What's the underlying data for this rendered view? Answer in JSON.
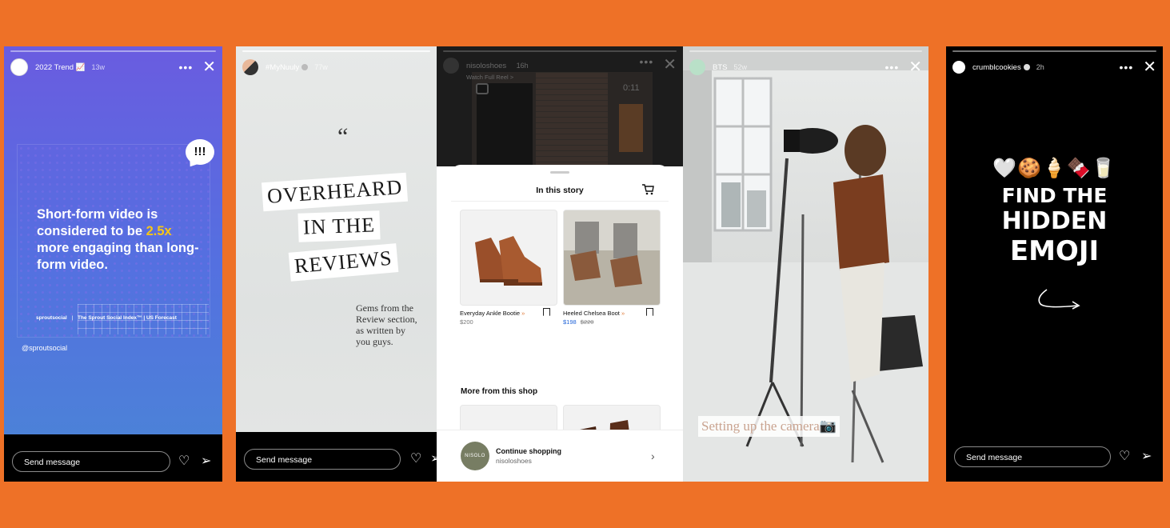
{
  "colors": {
    "background": "#ee7127",
    "accent_yellow": "#f5c518",
    "price_sale": "#1f63d8"
  },
  "stories": [
    {
      "username": "2022 Trend 📈",
      "time": "13w",
      "headline_pre": "Short-form video is considered to be ",
      "headline_highlight": "2.5x",
      "headline_post": " more engaging than long-form video.",
      "brand": "sproutsocial",
      "source": "The Sprout Social Index™ | US Forecast",
      "handle": "@sproutsocial",
      "bubble": "!!!",
      "send_placeholder": "Send message"
    },
    {
      "username": "#MyNuuly",
      "time": "77w",
      "quote_mark": "“",
      "title_lines": [
        "OVERHEARD",
        "IN THE",
        "REVIEWS"
      ],
      "subtitle_lines": [
        "Gems from the",
        "Review section,",
        "as written by",
        "you guys."
      ],
      "send_placeholder": "Send message"
    },
    {
      "username": "nisoloshoes",
      "time": "16h",
      "watch_label": "Watch Full Reel >",
      "video_time": "0:11",
      "sheet_title": "In this story",
      "products": [
        {
          "name": "Everyday Ankle Bootie",
          "price": "$200",
          "sale_price": "",
          "original_price": ""
        },
        {
          "name": "Heeled Chelsea Boot",
          "price": "",
          "sale_price": "$198",
          "original_price": "$220"
        }
      ],
      "more_title": "More from this shop",
      "continue_title": "Continue shopping",
      "continue_sub": "nisoloshoes",
      "logo_text": "NISOLO"
    },
    {
      "username": "BTS",
      "time": "52w",
      "caption": "Setting up the camera📷"
    },
    {
      "username": "crumblcookies",
      "time": "2h",
      "emojis": "🤍🍪🍦🍫🥛",
      "headline_lines": [
        "FIND THE",
        "HIDDEN",
        "EMOJI"
      ],
      "send_placeholder": "Send message"
    }
  ]
}
